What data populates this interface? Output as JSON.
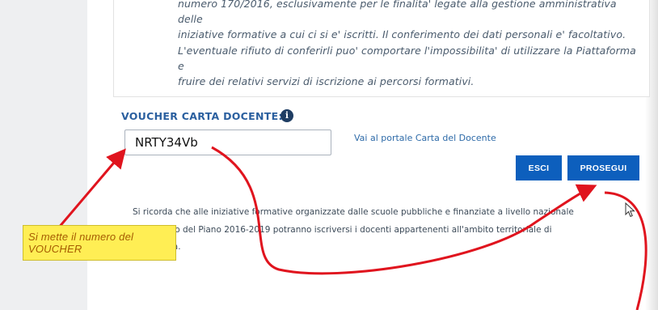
{
  "privacy": {
    "text": "numero 170/2016, esclusivamente per le finalita' legate alla gestione amministrativa delle\niniziative formative a cui ci si e' iscritti. Il conferimento dei dati personali e' facoltativo.\nL'eventuale rifiuto di conferirli puo' comportare l'impossibilita' di utilizzare la Piattaforma e\nfruire dei relativi servizi di iscrizione ai percorsi formativi."
  },
  "voucher": {
    "label": "VOUCHER CARTA DOCENTE:",
    "info_icon": "info-icon",
    "value": "NRTY34Vb",
    "portal_link": "Vai al portale Carta del Docente"
  },
  "actions": {
    "exit_label": "ESCI",
    "continue_label": "PROSEGUI",
    "button_color": "#0d5fbd"
  },
  "reminder": {
    "text": "Si ricorda che alle iniziative formative organizzate dalle scuole pubbliche e finanziate a livello nazionale\nnell'ambito del Piano 2016-2019 potranno iscriversi i docenti appartenenti all'ambito territoriale di\npertinenza."
  },
  "annotation": {
    "callout_text": "Si mette il numero del VOUCHER",
    "arrow_color": "#e0141e",
    "callout_color": "#ffee54"
  }
}
